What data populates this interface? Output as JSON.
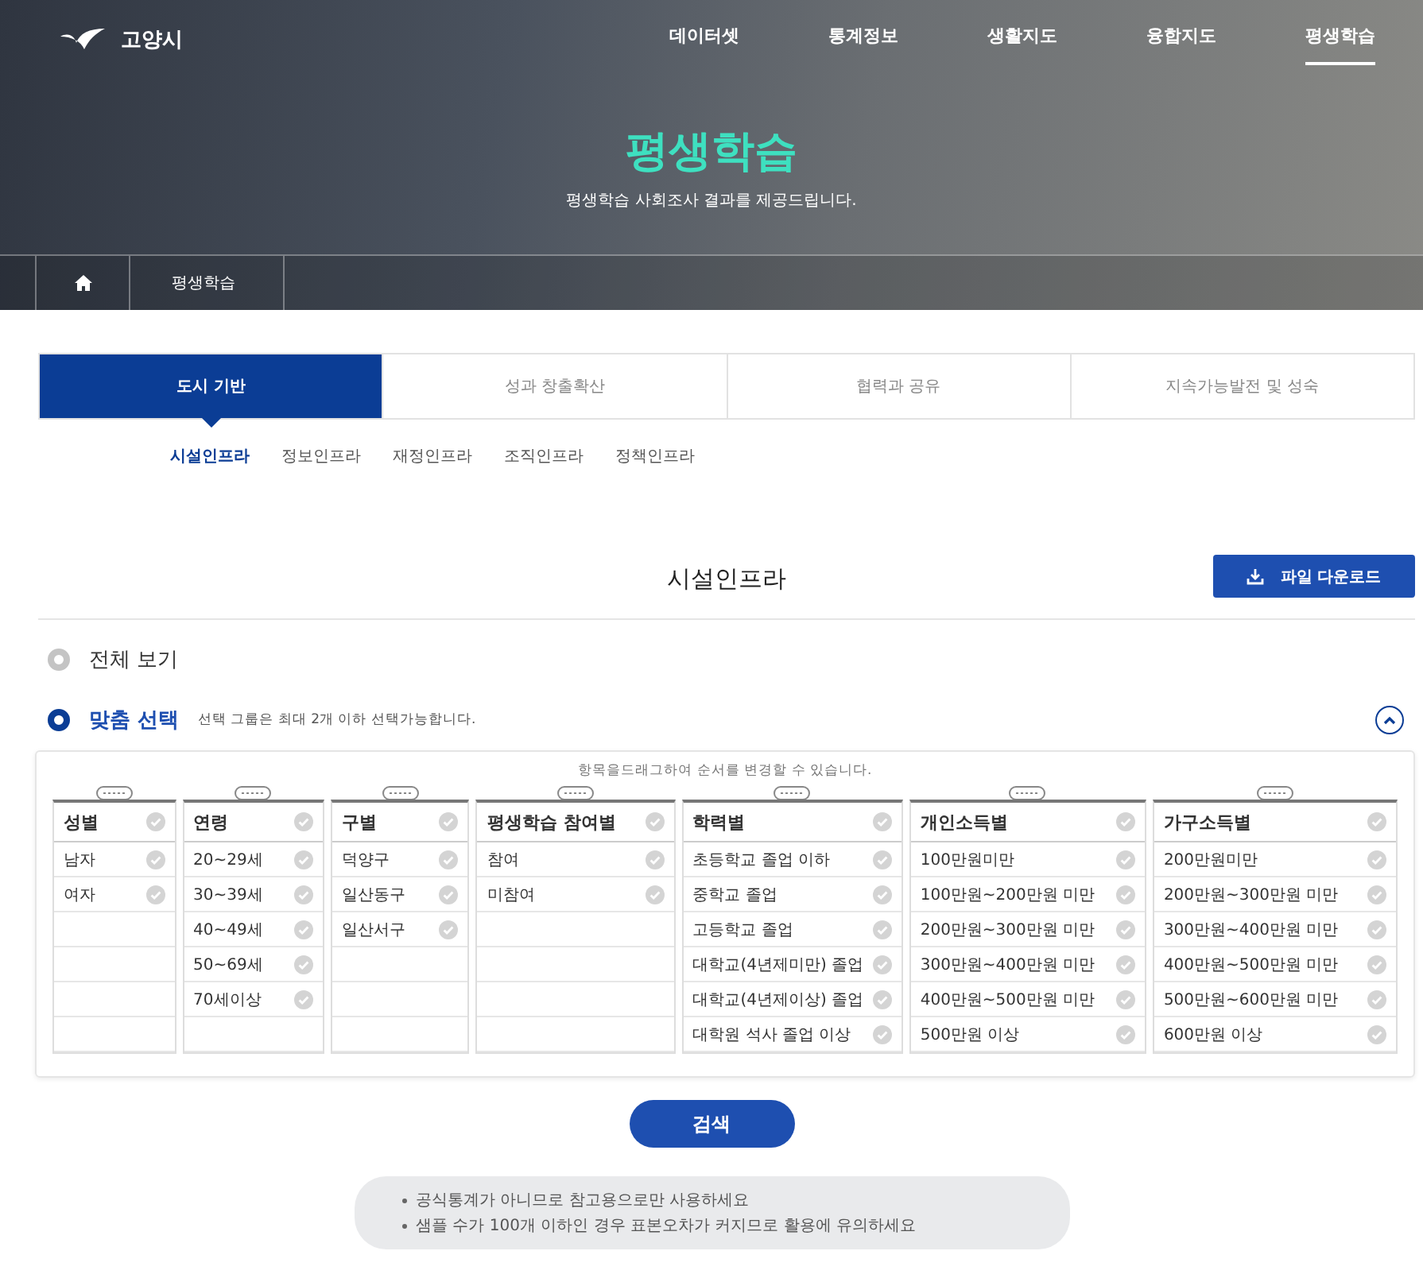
{
  "header": {
    "logo_text": "고양시",
    "nav": [
      {
        "label": "데이터셋",
        "selected": false
      },
      {
        "label": "통계정보",
        "selected": false
      },
      {
        "label": "생활지도",
        "selected": false
      },
      {
        "label": "융합지도",
        "selected": false
      },
      {
        "label": "평생학습",
        "selected": true
      }
    ]
  },
  "hero": {
    "title": "평생학습",
    "subtitle": "평생학습 사회조사 결과를 제공드립니다."
  },
  "breadcrumb": [
    "평생학습"
  ],
  "tabs": [
    {
      "label": "도시 기반",
      "selected": true
    },
    {
      "label": "성과 창출확산",
      "selected": false
    },
    {
      "label": "협력과 공유",
      "selected": false
    },
    {
      "label": "지속가능발전 및 성숙",
      "selected": false
    }
  ],
  "subtabs": [
    {
      "label": "시설인프라",
      "selected": true
    },
    {
      "label": "정보인프라",
      "selected": false
    },
    {
      "label": "재정인프라",
      "selected": false
    },
    {
      "label": "조직인프라",
      "selected": false
    },
    {
      "label": "정책인프라",
      "selected": false
    }
  ],
  "section_title": "시설인프라",
  "download_button": "파일 다운로드",
  "view_options": [
    {
      "label": "전체 보기",
      "selected": false
    },
    {
      "label": "맞춤 선택",
      "selected": true,
      "hint": "선택 그룹은 최대 2개 이하 선택가능합니다."
    }
  ],
  "panel": {
    "expanded": true,
    "drag_hint": "항목을드래그하여 순서를 변경할 수 있습니다.",
    "columns": [
      {
        "title": "성별",
        "checked": false,
        "items": [
          {
            "label": "남자",
            "checked": false
          },
          {
            "label": "여자",
            "checked": false
          }
        ]
      },
      {
        "title": "연령",
        "checked": false,
        "items": [
          {
            "label": "20~29세",
            "checked": false
          },
          {
            "label": "30~39세",
            "checked": false
          },
          {
            "label": "40~49세",
            "checked": false
          },
          {
            "label": "50~69세",
            "checked": false
          },
          {
            "label": "70세이상",
            "checked": false
          }
        ]
      },
      {
        "title": "구별",
        "checked": false,
        "items": [
          {
            "label": "덕양구",
            "checked": false
          },
          {
            "label": "일산동구",
            "checked": false
          },
          {
            "label": "일산서구",
            "checked": false
          }
        ]
      },
      {
        "title": "평생학습 참여별",
        "checked": false,
        "items": [
          {
            "label": "참여",
            "checked": false
          },
          {
            "label": "미참여",
            "checked": false
          }
        ]
      },
      {
        "title": "학력별",
        "checked": false,
        "items": [
          {
            "label": "초등학교 졸업 이하",
            "checked": false
          },
          {
            "label": "중학교 졸업",
            "checked": false
          },
          {
            "label": "고등학교 졸업",
            "checked": false
          },
          {
            "label": "대학교(4년제미만) 졸업",
            "checked": false
          },
          {
            "label": "대학교(4년제이상) 졸업",
            "checked": false
          },
          {
            "label": "대학원 석사 졸업 이상",
            "checked": false
          }
        ]
      },
      {
        "title": "개인소득별",
        "checked": false,
        "items": [
          {
            "label": "100만원미만",
            "checked": false
          },
          {
            "label": "100만원~200만원 미만",
            "checked": false
          },
          {
            "label": "200만원~300만원 미만",
            "checked": false
          },
          {
            "label": "300만원~400만원 미만",
            "checked": false
          },
          {
            "label": "400만원~500만원 미만",
            "checked": false
          },
          {
            "label": "500만원 이상",
            "checked": false
          }
        ]
      },
      {
        "title": "가구소득별",
        "checked": false,
        "items": [
          {
            "label": "200만원미만",
            "checked": false
          },
          {
            "label": "200만원~300만원 미만",
            "checked": false
          },
          {
            "label": "300만원~400만원 미만",
            "checked": false
          },
          {
            "label": "400만원~500만원 미만",
            "checked": false
          },
          {
            "label": "500만원~600만원 미만",
            "checked": false
          },
          {
            "label": "600만원 이상",
            "checked": false
          }
        ]
      }
    ]
  },
  "search_button": "검색",
  "notes": [
    "공식통계가 아니므로 참고용으로만 사용하세요",
    "샘플 수가 100개 이하인 경우 표본오차가 커지므로 활용에 유의하세요"
  ]
}
